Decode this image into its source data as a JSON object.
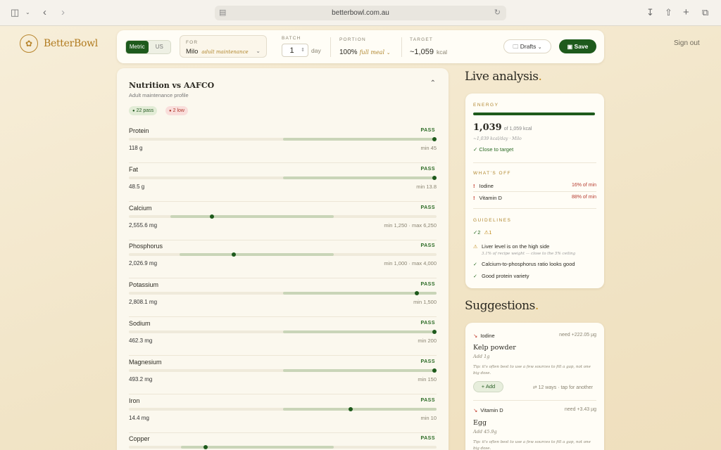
{
  "browser": {
    "url": "betterbowl.com.au",
    "icons": [
      "sidebar-icon",
      "chevron-down-icon",
      "back-icon",
      "forward-icon",
      "page-icon",
      "reload-icon",
      "download-icon",
      "share-icon",
      "plus-icon",
      "tabs-icon"
    ]
  },
  "app": {
    "brand": "BetterBowl",
    "sign_out": "Sign out",
    "accent": "#1e5a1c",
    "brand_color": "#b07a1e"
  },
  "toolbar": {
    "units": [
      "Metric",
      "US"
    ],
    "units_selected": "Metric",
    "for_label": "FOR",
    "for_pet": "Milo",
    "for_profile": "adult maintenance",
    "batch_label": "BATCH",
    "batch_value": "1",
    "batch_unit": "day",
    "portion_label": "PORTION",
    "portion_value": "100%",
    "portion_desc": "full meal",
    "target_label": "TARGET",
    "target_value": "~1,059",
    "target_unit": "kcal",
    "drafts_label": "Drafts",
    "save_label": "Save"
  },
  "nutrition": {
    "title": "Nutrition vs AAFCO",
    "subtitle": "Adult maintenance profile",
    "pass_count": "22 pass",
    "low_count": "2 low",
    "rows": [
      {
        "name": "Protein",
        "status": "PASS",
        "value": "118 g",
        "limit": "min 45",
        "band": [
          0.5,
          1.0
        ],
        "dot": 1.0
      },
      {
        "name": "Fat",
        "status": "PASS",
        "value": "48.5 g",
        "limit": "min 13.8",
        "band": [
          0.5,
          1.0
        ],
        "dot": 1.0
      },
      {
        "name": "Calcium",
        "status": "PASS",
        "value": "2,555.6 mg",
        "limit": "min 1,250 · max 6,250",
        "band": [
          0.135,
          0.665
        ],
        "dot": 0.27
      },
      {
        "name": "Phosphorus",
        "status": "PASS",
        "value": "2,026.9 mg",
        "limit": "min 1,000 · max 4,000",
        "band": [
          0.165,
          0.665
        ],
        "dot": 0.34
      },
      {
        "name": "Potassium",
        "status": "PASS",
        "value": "2,808.1 mg",
        "limit": "min 1,500",
        "band": [
          0.5,
          1.0
        ],
        "dot": 0.935
      },
      {
        "name": "Sodium",
        "status": "PASS",
        "value": "462.3 mg",
        "limit": "min 200",
        "band": [
          0.5,
          1.0
        ],
        "dot": 1.0
      },
      {
        "name": "Magnesium",
        "status": "PASS",
        "value": "493.2 mg",
        "limit": "min 150",
        "band": [
          0.5,
          1.0
        ],
        "dot": 1.0
      },
      {
        "name": "Iron",
        "status": "PASS",
        "value": "14.4 mg",
        "limit": "min 10",
        "band": [
          0.5,
          1.0
        ],
        "dot": 0.72
      },
      {
        "name": "Copper",
        "status": "PASS",
        "value": "",
        "limit": "",
        "band": [
          0.17,
          0.665
        ],
        "dot": 0.25
      }
    ]
  },
  "analysis": {
    "heading": "Live analysis",
    "energy_label": "ENERGY",
    "energy_value": "1,039",
    "energy_of": "of 1,059 kcal",
    "energy_note": "~1,039 kcal/day · Milo",
    "energy_fraction": 0.98,
    "close_label": "Close to target",
    "off_label": "WHAT'S OFF",
    "off_items": [
      {
        "name": "Iodine",
        "pct": "16% of min"
      },
      {
        "name": "Vitamin D",
        "pct": "88% of min"
      }
    ],
    "guidelines_label": "GUIDELINES",
    "guide_ok": "2",
    "guide_warn": "1",
    "guidelines": [
      {
        "kind": "warn",
        "text": "Liver level is on the high side",
        "note": "3.1% of recipe weight — close to the 5% ceiling"
      },
      {
        "kind": "ok",
        "text": "Calcium-to-phosphorus ratio looks good",
        "note": ""
      },
      {
        "kind": "ok",
        "text": "Good protein variety",
        "note": ""
      }
    ]
  },
  "suggestions": {
    "heading": "Suggestions",
    "items": [
      {
        "nutrient": "Iodine",
        "need": "need +222.05 µg",
        "food": "Kelp powder",
        "add": "Add 1g",
        "tip": "Tip: it's often best to use a few sources to fill a gap, not one big dose.",
        "add_btn": "+ Add",
        "ways": "12 ways · tap for another"
      },
      {
        "nutrient": "Vitamin D",
        "need": "need +3.43 µg",
        "food": "Egg",
        "add": "Add 45.9g",
        "tip": "Tip: it's often best to use a few sources to fill a gap, not one big dose."
      }
    ]
  }
}
